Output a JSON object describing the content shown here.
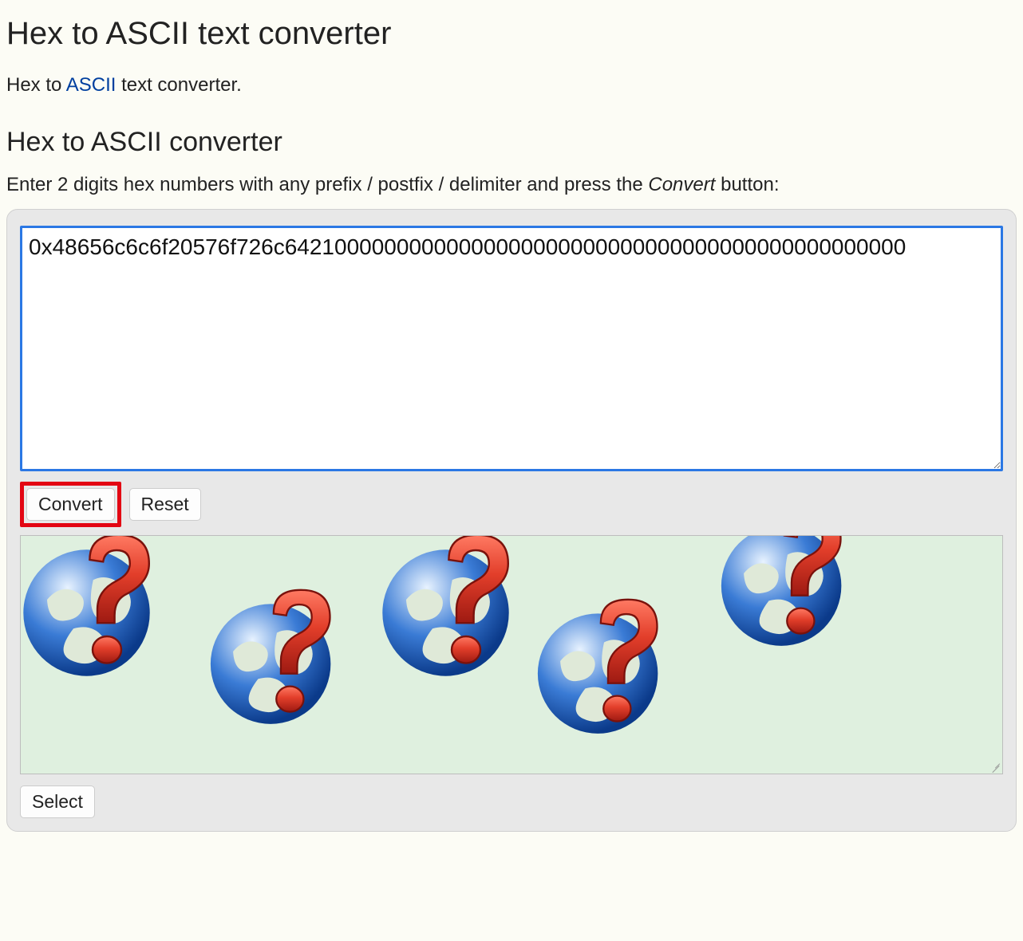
{
  "page": {
    "h1": "Hex to ASCII text converter",
    "intro_pre": "Hex to ",
    "intro_link": "ASCII",
    "intro_post": " text converter.",
    "h2": "Hex to ASCII converter",
    "instruction_pre": "Enter 2 digits hex numbers with any prefix / postfix / delimiter and press the ",
    "instruction_em": "Convert",
    "instruction_post": " button:"
  },
  "form": {
    "hex_value": "0x48656c6c6f20576f726c64210000000000000000000000000000000000000000000000",
    "convert_label": "Convert",
    "reset_label": "Reset",
    "select_label": "Select"
  },
  "output": {
    "graphic_count": 5,
    "icon_desc": "globe-with-question-mark"
  }
}
